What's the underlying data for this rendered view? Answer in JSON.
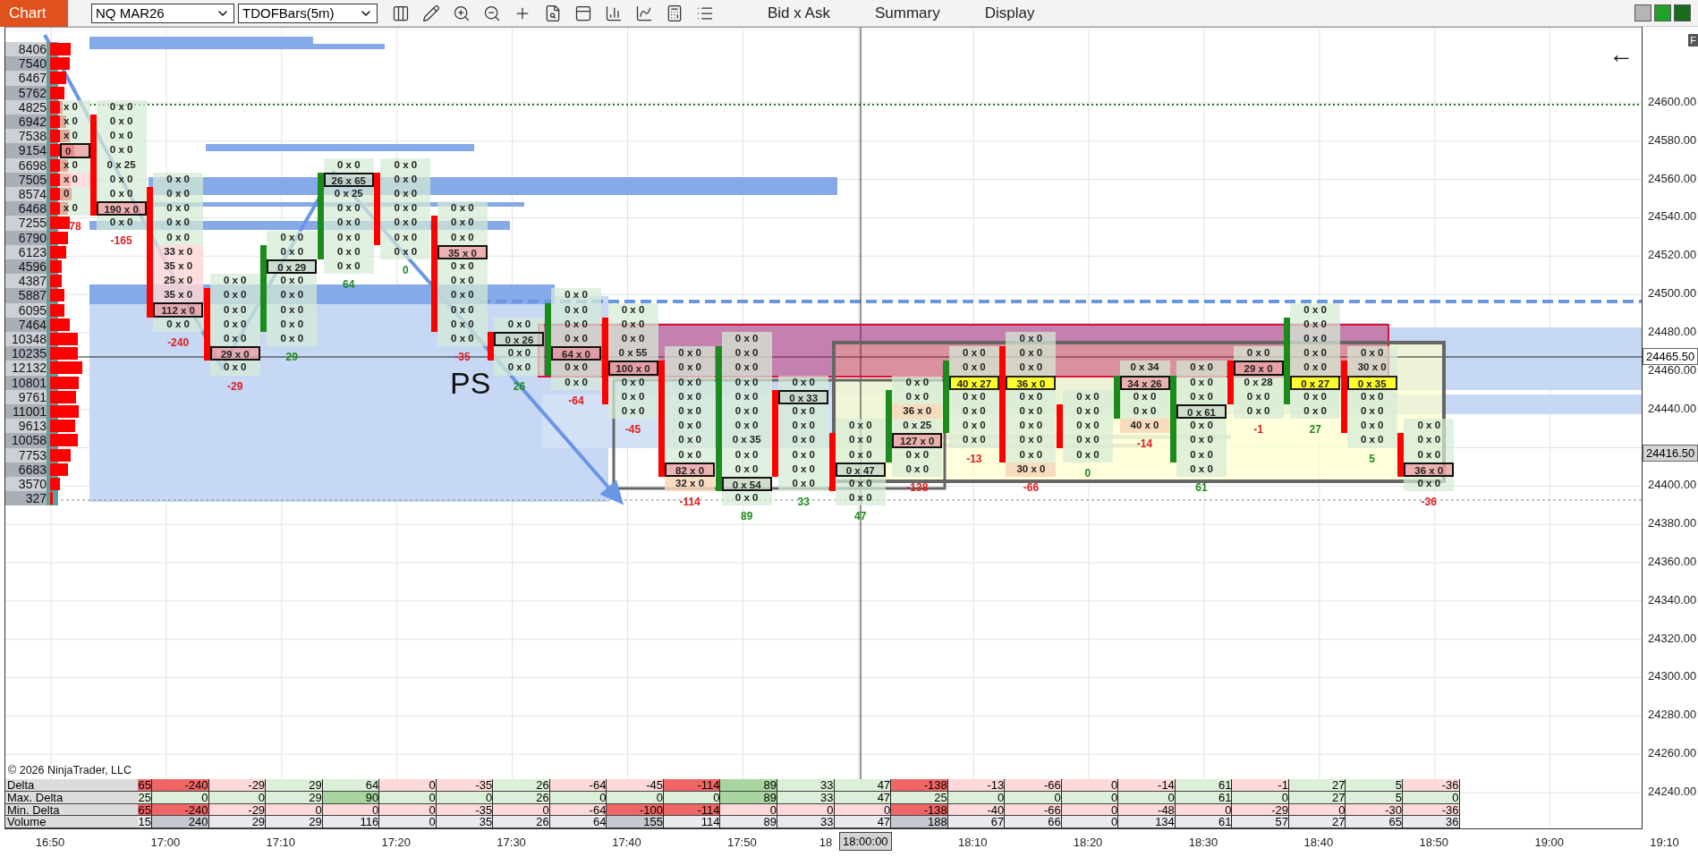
{
  "toolbar": {
    "tab": "Chart",
    "instrument": "NQ MAR26",
    "bar_type": "TDOFBars(5m)",
    "menus": [
      "Bid x Ask",
      "Summary",
      "Display"
    ]
  },
  "ladder": [
    "8406",
    "7540",
    "6467",
    "5762",
    "4825",
    "6942",
    "7538",
    "9154",
    "6698",
    "7505",
    "8574",
    "6468",
    "7255",
    "6790",
    "6123",
    "4596",
    "4387",
    "5887",
    "6095",
    "7464",
    "10348",
    "10235",
    "12132",
    "10801",
    "9761",
    "11001",
    "9613",
    "10058",
    "7753",
    "6683",
    "3570",
    "327"
  ],
  "partial_bar": {
    "delta": "78",
    "delta_negative": true,
    "cells": [
      {
        "text": "x 0",
        "kind": "plain"
      },
      {
        "text": "x 0",
        "kind": "plain"
      },
      {
        "text": "x 0",
        "kind": "plain"
      },
      {
        "text": "0",
        "kind": "box"
      },
      {
        "text": "x 0",
        "kind": "plain"
      },
      {
        "text": "x 0",
        "kind": "pink"
      },
      {
        "text": "0",
        "kind": "plain"
      },
      {
        "text": "x 0",
        "kind": "plain"
      }
    ]
  },
  "bars": [
    {
      "rising": false,
      "delta": "-165",
      "delta_negative": true,
      "cells": [
        {
          "text": "0 x 0",
          "kind": "plain"
        },
        {
          "text": "0 x 0",
          "kind": "plain"
        },
        {
          "text": "0 x 0",
          "kind": "plain"
        },
        {
          "text": "0 x 0",
          "kind": "plain"
        },
        {
          "text": "0 x 25",
          "kind": "plain"
        },
        {
          "text": "0 x 0",
          "kind": "plain"
        },
        {
          "text": "0 x 0",
          "kind": "plain"
        },
        {
          "text": "190 x 0",
          "kind": "box"
        },
        {
          "text": "0 x 0",
          "kind": "plain"
        }
      ]
    },
    {
      "rising": false,
      "delta": "-240",
      "delta_negative": true,
      "cells": [
        {
          "text": "0 x 0",
          "kind": "plain"
        },
        {
          "text": "0 x 0",
          "kind": "plain"
        },
        {
          "text": "0 x 0",
          "kind": "plain"
        },
        {
          "text": "0 x 0",
          "kind": "plain"
        },
        {
          "text": "0 x 0",
          "kind": "plain"
        },
        {
          "text": "33 x 0",
          "kind": "pink"
        },
        {
          "text": "35 x 0",
          "kind": "pink"
        },
        {
          "text": "25 x 0",
          "kind": "pink"
        },
        {
          "text": "35 x 0",
          "kind": "pink"
        },
        {
          "text": "112 x 0",
          "kind": "box"
        },
        {
          "text": "0 x 0",
          "kind": "plain"
        }
      ]
    },
    {
      "rising": false,
      "delta": "-29",
      "delta_negative": true,
      "cells": [
        {
          "text": "0 x 0",
          "kind": "plain"
        },
        {
          "text": "0 x 0",
          "kind": "plain"
        },
        {
          "text": "0 x 0",
          "kind": "plain"
        },
        {
          "text": "0 x 0",
          "kind": "plain"
        },
        {
          "text": "0 x 0",
          "kind": "plain"
        },
        {
          "text": "29 x 0",
          "kind": "box"
        },
        {
          "text": "0 x 0",
          "kind": "plain"
        }
      ]
    },
    {
      "rising": true,
      "delta": "29",
      "delta_negative": false,
      "cells": [
        {
          "text": "0 x 0",
          "kind": "plain"
        },
        {
          "text": "0 x 0",
          "kind": "plain"
        },
        {
          "text": "0 x 29",
          "kind": "ask-box"
        },
        {
          "text": "0 x 0",
          "kind": "plain"
        },
        {
          "text": "0 x 0",
          "kind": "plain"
        },
        {
          "text": "0 x 0",
          "kind": "plain"
        },
        {
          "text": "0 x 0",
          "kind": "plain"
        },
        {
          "text": "0 x 0",
          "kind": "plain"
        }
      ]
    },
    {
      "rising": true,
      "delta": "64",
      "delta_negative": false,
      "cells": [
        {
          "text": "0 x 0",
          "kind": "plain"
        },
        {
          "text": "26 x 65",
          "kind": "ask-box"
        },
        {
          "text": "0 x 25",
          "kind": "plain"
        },
        {
          "text": "0 x 0",
          "kind": "plain"
        },
        {
          "text": "0 x 0",
          "kind": "plain"
        },
        {
          "text": "0 x 0",
          "kind": "plain"
        },
        {
          "text": "0 x 0",
          "kind": "plain"
        },
        {
          "text": "0 x 0",
          "kind": "plain"
        }
      ]
    },
    {
      "rising": false,
      "delta": "0",
      "delta_negative": false,
      "cells": [
        {
          "text": "0 x 0",
          "kind": "plain"
        },
        {
          "text": "0 x 0",
          "kind": "plain"
        },
        {
          "text": "0 x 0",
          "kind": "plain"
        },
        {
          "text": "0 x 0",
          "kind": "plain"
        },
        {
          "text": "0 x 0",
          "kind": "plain"
        },
        {
          "text": "0 x 0",
          "kind": "plain"
        },
        {
          "text": "0 x 0",
          "kind": "plain"
        }
      ]
    },
    {
      "rising": false,
      "delta": "-35",
      "delta_negative": true,
      "cells": [
        {
          "text": "0 x 0",
          "kind": "plain"
        },
        {
          "text": "0 x 0",
          "kind": "plain"
        },
        {
          "text": "0 x 0",
          "kind": "plain"
        },
        {
          "text": "35 x 0",
          "kind": "box"
        },
        {
          "text": "0 x 0",
          "kind": "plain"
        },
        {
          "text": "0 x 0",
          "kind": "plain"
        },
        {
          "text": "0 x 0",
          "kind": "plain"
        },
        {
          "text": "0 x 0",
          "kind": "plain"
        },
        {
          "text": "0 x 0",
          "kind": "plain"
        },
        {
          "text": "0 x 0",
          "kind": "plain"
        }
      ]
    },
    {
      "rising": false,
      "delta": "26",
      "delta_negative": false,
      "cells": [
        {
          "text": "0 x 0",
          "kind": "plain"
        },
        {
          "text": "0 x 26",
          "kind": "ask-box"
        },
        {
          "text": "0 x 0",
          "kind": "plain"
        },
        {
          "text": "0 x 0",
          "kind": "plain"
        }
      ]
    },
    {
      "rising": true,
      "delta": "-64",
      "delta_negative": true,
      "cells": [
        {
          "text": "0 x 0",
          "kind": "plain"
        },
        {
          "text": "0 x 0",
          "kind": "plain"
        },
        {
          "text": "0 x 0",
          "kind": "plain"
        },
        {
          "text": "0 x 0",
          "kind": "plain"
        },
        {
          "text": "64 x 0",
          "kind": "box"
        },
        {
          "text": "0 x 0",
          "kind": "plain"
        },
        {
          "text": "0 x 0",
          "kind": "plain"
        }
      ]
    },
    {
      "rising": false,
      "delta": "-45",
      "delta_negative": true,
      "cells": [
        {
          "text": "0 x 0",
          "kind": "plain"
        },
        {
          "text": "0 x 0",
          "kind": "plain"
        },
        {
          "text": "0 x 0",
          "kind": "plain"
        },
        {
          "text": "0 x 55",
          "kind": "plain"
        },
        {
          "text": "100 x 0",
          "kind": "box"
        },
        {
          "text": "0 x 0",
          "kind": "plain"
        },
        {
          "text": "0 x 0",
          "kind": "plain"
        },
        {
          "text": "0 x 0",
          "kind": "plain"
        }
      ]
    },
    {
      "rising": false,
      "delta": "-114",
      "delta_negative": true,
      "cells": [
        {
          "text": "0 x 0",
          "kind": "plain"
        },
        {
          "text": "0 x 0",
          "kind": "plain"
        },
        {
          "text": "0 x 0",
          "kind": "plain"
        },
        {
          "text": "0 x 0",
          "kind": "plain"
        },
        {
          "text": "0 x 0",
          "kind": "plain"
        },
        {
          "text": "0 x 0",
          "kind": "plain"
        },
        {
          "text": "0 x 0",
          "kind": "plain"
        },
        {
          "text": "0 x 0",
          "kind": "plain"
        },
        {
          "text": "82 x 0",
          "kind": "box"
        },
        {
          "text": "32 x 0",
          "kind": "peach"
        }
      ]
    },
    {
      "rising": true,
      "delta": "89",
      "delta_negative": false,
      "cells": [
        {
          "text": "0 x 0",
          "kind": "plain"
        },
        {
          "text": "0 x 0",
          "kind": "plain"
        },
        {
          "text": "0 x 0",
          "kind": "plain"
        },
        {
          "text": "0 x 0",
          "kind": "plain"
        },
        {
          "text": "0 x 0",
          "kind": "plain"
        },
        {
          "text": "0 x 0",
          "kind": "plain"
        },
        {
          "text": "0 x 0",
          "kind": "plain"
        },
        {
          "text": "0 x 35",
          "kind": "plain"
        },
        {
          "text": "0 x 0",
          "kind": "plain"
        },
        {
          "text": "0 x 0",
          "kind": "plain"
        },
        {
          "text": "0 x 54",
          "kind": "ask-box"
        },
        {
          "text": "0 x 0",
          "kind": "plain"
        }
      ]
    },
    {
      "rising": false,
      "delta": "33",
      "delta_negative": false,
      "cells": [
        {
          "text": "0 x 0",
          "kind": "plain"
        },
        {
          "text": "0 x 33",
          "kind": "ask-box"
        },
        {
          "text": "0 x 0",
          "kind": "plain"
        },
        {
          "text": "0 x 0",
          "kind": "plain"
        },
        {
          "text": "0 x 0",
          "kind": "plain"
        },
        {
          "text": "0 x 0",
          "kind": "plain"
        },
        {
          "text": "0 x 0",
          "kind": "plain"
        },
        {
          "text": "0 x 0",
          "kind": "plain"
        }
      ]
    },
    {
      "rising": false,
      "delta": "47",
      "delta_negative": false,
      "cells": [
        {
          "text": "0 x 0",
          "kind": "plain"
        },
        {
          "text": "0 x 0",
          "kind": "plain"
        },
        {
          "text": "0 x 0",
          "kind": "plain"
        },
        {
          "text": "0 x 47",
          "kind": "ask-box"
        },
        {
          "text": "0 x 0",
          "kind": "plain"
        },
        {
          "text": "0 x 0",
          "kind": "plain"
        }
      ]
    },
    {
      "rising": true,
      "delta": "-138",
      "delta_negative": true,
      "cells": [
        {
          "text": "0 x 0",
          "kind": "plain"
        },
        {
          "text": "0 x 0",
          "kind": "plain"
        },
        {
          "text": "36 x 0",
          "kind": "peach"
        },
        {
          "text": "0 x 25",
          "kind": "plain"
        },
        {
          "text": "127 x 0",
          "kind": "box"
        },
        {
          "text": "0 x 0",
          "kind": "plain"
        },
        {
          "text": "0 x 0",
          "kind": "plain"
        }
      ]
    },
    {
      "rising": true,
      "delta": "-13",
      "delta_negative": true,
      "cells": [
        {
          "text": "0 x 0",
          "kind": "plain"
        },
        {
          "text": "0 x 0",
          "kind": "plain"
        },
        {
          "text": "40 x 27",
          "kind": "yellow"
        },
        {
          "text": "0 x 0",
          "kind": "plain"
        },
        {
          "text": "0 x 0",
          "kind": "plain"
        },
        {
          "text": "0 x 0",
          "kind": "plain"
        },
        {
          "text": "0 x 0",
          "kind": "plain"
        }
      ]
    },
    {
      "rising": false,
      "delta": "-66",
      "delta_negative": true,
      "cells": [
        {
          "text": "0 x 0",
          "kind": "plain"
        },
        {
          "text": "0 x 0",
          "kind": "plain"
        },
        {
          "text": "0 x 0",
          "kind": "plain"
        },
        {
          "text": "36 x 0",
          "kind": "yellow"
        },
        {
          "text": "0 x 0",
          "kind": "plain"
        },
        {
          "text": "0 x 0",
          "kind": "plain"
        },
        {
          "text": "0 x 0",
          "kind": "plain"
        },
        {
          "text": "0 x 0",
          "kind": "plain"
        },
        {
          "text": "0 x 0",
          "kind": "plain"
        },
        {
          "text": "30 x 0",
          "kind": "peach"
        }
      ]
    },
    {
      "rising": false,
      "delta": "0",
      "delta_negative": false,
      "cells": [
        {
          "text": "0 x 0",
          "kind": "plain"
        },
        {
          "text": "0 x 0",
          "kind": "plain"
        },
        {
          "text": "0 x 0",
          "kind": "plain"
        },
        {
          "text": "0 x 0",
          "kind": "plain"
        },
        {
          "text": "0 x 0",
          "kind": "plain"
        }
      ]
    },
    {
      "rising": true,
      "delta": "-14",
      "delta_negative": true,
      "cells": [
        {
          "text": "0 x 34",
          "kind": "plain"
        },
        {
          "text": "34 x 26",
          "kind": "box"
        },
        {
          "text": "0 x 0",
          "kind": "plain"
        },
        {
          "text": "0 x 0",
          "kind": "plain"
        },
        {
          "text": "40 x 0",
          "kind": "peach"
        }
      ]
    },
    {
      "rising": true,
      "delta": "61",
      "delta_negative": false,
      "cells": [
        {
          "text": "0 x 0",
          "kind": "plain"
        },
        {
          "text": "0 x 0",
          "kind": "plain"
        },
        {
          "text": "0 x 0",
          "kind": "plain"
        },
        {
          "text": "0 x 61",
          "kind": "ask-box"
        },
        {
          "text": "0 x 0",
          "kind": "plain"
        },
        {
          "text": "0 x 0",
          "kind": "plain"
        },
        {
          "text": "0 x 0",
          "kind": "plain"
        },
        {
          "text": "0 x 0",
          "kind": "plain"
        }
      ]
    },
    {
      "rising": false,
      "delta": "-1",
      "delta_negative": true,
      "cells": [
        {
          "text": "0 x 0",
          "kind": "plain"
        },
        {
          "text": "29 x 0",
          "kind": "box"
        },
        {
          "text": "0 x 28",
          "kind": "plain"
        },
        {
          "text": "0 x 0",
          "kind": "plain"
        },
        {
          "text": "0 x 0",
          "kind": "plain"
        }
      ]
    },
    {
      "rising": true,
      "delta": "27",
      "delta_negative": false,
      "cells": [
        {
          "text": "0 x 0",
          "kind": "plain"
        },
        {
          "text": "0 x 0",
          "kind": "plain"
        },
        {
          "text": "0 x 0",
          "kind": "plain"
        },
        {
          "text": "0 x 0",
          "kind": "plain"
        },
        {
          "text": "0 x 0",
          "kind": "plain"
        },
        {
          "text": "0 x 27",
          "kind": "yellow"
        },
        {
          "text": "0 x 0",
          "kind": "plain"
        },
        {
          "text": "0 x 0",
          "kind": "plain"
        }
      ]
    },
    {
      "rising": false,
      "delta": "5",
      "delta_negative": false,
      "cells": [
        {
          "text": "0 x 0",
          "kind": "plain"
        },
        {
          "text": "30 x 0",
          "kind": "plain"
        },
        {
          "text": "0 x 35",
          "kind": "yellow"
        },
        {
          "text": "0 x 0",
          "kind": "plain"
        },
        {
          "text": "0 x 0",
          "kind": "plain"
        },
        {
          "text": "0 x 0",
          "kind": "plain"
        },
        {
          "text": "0 x 0",
          "kind": "plain"
        }
      ]
    },
    {
      "rising": false,
      "delta": "-36",
      "delta_negative": true,
      "cells": [
        {
          "text": "0 x 0",
          "kind": "plain"
        },
        {
          "text": "0 x 0",
          "kind": "plain"
        },
        {
          "text": "0 x 0",
          "kind": "plain"
        },
        {
          "text": "36 x 0",
          "kind": "box"
        },
        {
          "text": "0 x 0",
          "kind": "plain"
        }
      ]
    }
  ],
  "annotation": "PS",
  "back_arrow": "←",
  "corner_tag": "F",
  "price_axis": {
    "labels": [
      "24600.00",
      "24580.00",
      "24560.00",
      "24540.00",
      "24520.00",
      "24500.00",
      "24480.00",
      "24460.00",
      "24440.00",
      "24400.00",
      "24380.00",
      "24360.00",
      "24340.00",
      "24320.00",
      "24300.00",
      "24280.00",
      "24260.00",
      "24240.00"
    ],
    "tags": [
      {
        "text": "24465.50",
        "kind": "current"
      },
      {
        "text": "24416.50",
        "kind": "marker"
      }
    ]
  },
  "stats": {
    "rows": [
      {
        "label": "Delta",
        "cells": [
          {
            "text": "65",
            "kind": "strong-neg"
          },
          {
            "text": "-240",
            "kind": "strong-neg"
          },
          {
            "text": "-29",
            "kind": "neg"
          },
          {
            "text": "29",
            "kind": "pos"
          },
          {
            "text": "64",
            "kind": "pos"
          },
          {
            "text": "0",
            "kind": "neg"
          },
          {
            "text": "-35",
            "kind": "neg"
          },
          {
            "text": "26",
            "kind": "pos"
          },
          {
            "text": "-64",
            "kind": "neg"
          },
          {
            "text": "-45",
            "kind": "neg"
          },
          {
            "text": "-114",
            "kind": "strong-neg"
          },
          {
            "text": "89",
            "kind": "strong-pos"
          },
          {
            "text": "33",
            "kind": "pos"
          },
          {
            "text": "47",
            "kind": "pos"
          },
          {
            "text": "-138",
            "kind": "strong-neg"
          },
          {
            "text": "-13",
            "kind": "neg"
          },
          {
            "text": "-66",
            "kind": "neg"
          },
          {
            "text": "0",
            "kind": "neg"
          },
          {
            "text": "-14",
            "kind": "neg"
          },
          {
            "text": "61",
            "kind": "pos"
          },
          {
            "text": "-1",
            "kind": "neg"
          },
          {
            "text": "27",
            "kind": "pos"
          },
          {
            "text": "5",
            "kind": "pos"
          },
          {
            "text": "-36",
            "kind": "neg"
          }
        ]
      },
      {
        "label": "Max. Delta",
        "cells": [
          {
            "text": "25",
            "kind": "pos"
          },
          {
            "text": "0",
            "kind": "pos"
          },
          {
            "text": "0",
            "kind": "pos"
          },
          {
            "text": "29",
            "kind": "pos"
          },
          {
            "text": "90",
            "kind": "strong-pos"
          },
          {
            "text": "0",
            "kind": "pos"
          },
          {
            "text": "0",
            "kind": "pos"
          },
          {
            "text": "26",
            "kind": "pos"
          },
          {
            "text": "0",
            "kind": "pos"
          },
          {
            "text": "0",
            "kind": "pos"
          },
          {
            "text": "0",
            "kind": "pos"
          },
          {
            "text": "89",
            "kind": "strong-pos"
          },
          {
            "text": "33",
            "kind": "pos"
          },
          {
            "text": "47",
            "kind": "pos"
          },
          {
            "text": "25",
            "kind": "pos"
          },
          {
            "text": "0",
            "kind": "pos"
          },
          {
            "text": "0",
            "kind": "pos"
          },
          {
            "text": "0",
            "kind": "pos"
          },
          {
            "text": "0",
            "kind": "pos"
          },
          {
            "text": "61",
            "kind": "pos"
          },
          {
            "text": "0",
            "kind": "pos"
          },
          {
            "text": "27",
            "kind": "pos"
          },
          {
            "text": "5",
            "kind": "pos"
          },
          {
            "text": "0",
            "kind": "pos"
          }
        ]
      },
      {
        "label": "Min. Delta",
        "cells": [
          {
            "text": "65",
            "kind": "strong-neg"
          },
          {
            "text": "-240",
            "kind": "strong-neg"
          },
          {
            "text": "-29",
            "kind": "neg"
          },
          {
            "text": "0",
            "kind": "neg"
          },
          {
            "text": "0",
            "kind": "neg"
          },
          {
            "text": "0",
            "kind": "neg"
          },
          {
            "text": "-35",
            "kind": "neg"
          },
          {
            "text": "0",
            "kind": "neg"
          },
          {
            "text": "-64",
            "kind": "neg"
          },
          {
            "text": "-100",
            "kind": "strong-neg"
          },
          {
            "text": "-114",
            "kind": "strong-neg"
          },
          {
            "text": "0",
            "kind": "neg"
          },
          {
            "text": "0",
            "kind": "neg"
          },
          {
            "text": "0",
            "kind": "neg"
          },
          {
            "text": "-138",
            "kind": "strong-neg"
          },
          {
            "text": "-40",
            "kind": "neg"
          },
          {
            "text": "-66",
            "kind": "neg"
          },
          {
            "text": "0",
            "kind": "neg"
          },
          {
            "text": "-48",
            "kind": "neg"
          },
          {
            "text": "0",
            "kind": "neg"
          },
          {
            "text": "-29",
            "kind": "neg"
          },
          {
            "text": "0",
            "kind": "neg"
          },
          {
            "text": "-30",
            "kind": "neg"
          },
          {
            "text": "-36",
            "kind": "neg"
          }
        ]
      },
      {
        "label": "Volume",
        "cells": [
          {
            "text": "15",
            "kind": "vol"
          },
          {
            "text": "240",
            "kind": "vol-hi"
          },
          {
            "text": "29",
            "kind": "vol"
          },
          {
            "text": "29",
            "kind": "vol"
          },
          {
            "text": "116",
            "kind": "vol"
          },
          {
            "text": "0",
            "kind": "vol"
          },
          {
            "text": "35",
            "kind": "vol"
          },
          {
            "text": "26",
            "kind": "vol"
          },
          {
            "text": "64",
            "kind": "vol"
          },
          {
            "text": "155",
            "kind": "vol-hi"
          },
          {
            "text": "114",
            "kind": "vol"
          },
          {
            "text": "89",
            "kind": "vol"
          },
          {
            "text": "33",
            "kind": "vol"
          },
          {
            "text": "47",
            "kind": "vol"
          },
          {
            "text": "188",
            "kind": "vol-hi"
          },
          {
            "text": "67",
            "kind": "vol"
          },
          {
            "text": "66",
            "kind": "vol"
          },
          {
            "text": "0",
            "kind": "vol"
          },
          {
            "text": "134",
            "kind": "vol"
          },
          {
            "text": "61",
            "kind": "vol"
          },
          {
            "text": "57",
            "kind": "vol"
          },
          {
            "text": "27",
            "kind": "vol"
          },
          {
            "text": "65",
            "kind": "vol"
          },
          {
            "text": "36",
            "kind": "vol"
          }
        ]
      }
    ]
  },
  "copyright": "© 2026 NinjaTrader, LLC",
  "time_axis": {
    "labels": [
      "16:50",
      "17:00",
      "17:10",
      "17:20",
      "17:30",
      "17:40",
      "17:50",
      "18",
      "18:10",
      "18:20",
      "18:30",
      "18:40",
      "18:50",
      "19:00",
      "19:10"
    ],
    "cursor": "18:00:00"
  }
}
